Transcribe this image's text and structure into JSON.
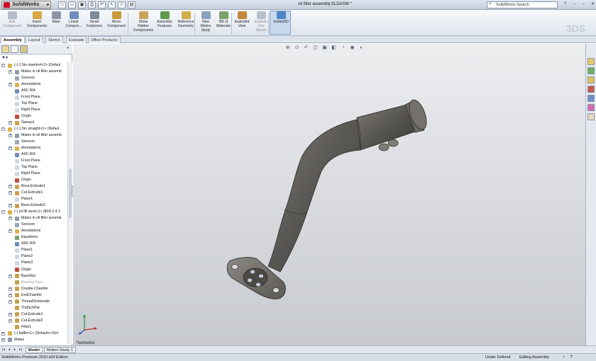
{
  "app": {
    "brand": "SolidWorks",
    "window_title": "oil filler assembly.SLDASM *"
  },
  "quick_access": [
    {
      "name": "new-icon",
      "glyph": "□"
    },
    {
      "name": "open-icon",
      "glyph": "▭"
    },
    {
      "name": "save-icon",
      "glyph": "▣"
    },
    {
      "name": "print-icon",
      "glyph": "⎙"
    },
    {
      "name": "undo-icon",
      "glyph": "↶"
    },
    {
      "name": "select-icon",
      "glyph": "↖"
    },
    {
      "name": "rebuild-icon",
      "glyph": "⚐"
    },
    {
      "name": "options-icon",
      "glyph": "▤"
    }
  ],
  "search": {
    "value": "SolidWorks Search"
  },
  "window_controls": [
    "?",
    "−",
    "▫",
    "✕"
  ],
  "commands": [
    {
      "name": "edit-component",
      "label": "Edit\nComponent",
      "disabled": true,
      "color": "#b4bcc8"
    },
    {
      "name": "insert-components",
      "label": "Insert\nComponents",
      "color": "#d7a640"
    },
    {
      "name": "mate",
      "label": "Mate",
      "color": "#8a96a8"
    },
    {
      "name": "linear-component-pattern",
      "label": "Linear\nCompon...",
      "color": "#6f8fc2"
    },
    {
      "name": "smart-fasteners",
      "label": "Smart\nFasteners",
      "color": "#7e8a99"
    },
    {
      "name": "move-component",
      "label": "Move\nComponent",
      "color": "#c99a3a"
    },
    {
      "name": "show-hidden-components",
      "label": "Show\nHidden\nComponents",
      "color": "#c9a45a"
    },
    {
      "name": "assembly-features",
      "label": "Assembly\nFeatures",
      "color": "#5f9a4f"
    },
    {
      "name": "reference-geometry",
      "label": "Reference\nGeometry",
      "color": "#d2b04c"
    },
    {
      "name": "new-motion-study",
      "label": "New\nMotion\nStudy",
      "color": "#8ca0bb"
    },
    {
      "name": "bill-of-materials",
      "label": "Bill of\nMaterials",
      "color": "#7ca06a"
    },
    {
      "name": "exploded-view",
      "label": "Exploded\nView",
      "color": "#c0893a"
    },
    {
      "name": "explode-line-sketch",
      "label": "Explode\nLine\nSketch",
      "disabled": true,
      "color": "#b7bfcb"
    },
    {
      "name": "instant3d",
      "label": "Instant3D",
      "color": "#4f86c6"
    }
  ],
  "tabs": [
    "Assembly",
    "Layout",
    "Sketch",
    "Evaluate",
    "Office Products"
  ],
  "active_tab": "Assembly",
  "tree": [
    {
      "depth": 0,
      "exp": "−",
      "icon": "part",
      "text": "(-) 1.5in mandrel<2> (Defaul"
    },
    {
      "depth": 1,
      "exp": "+",
      "icon": "mates",
      "text": "Mates in oil filler assemb"
    },
    {
      "depth": 1,
      "exp": "",
      "icon": "sensor",
      "text": "Sensors"
    },
    {
      "depth": 1,
      "exp": "+",
      "icon": "annot",
      "text": "Annotations"
    },
    {
      "depth": 1,
      "exp": "",
      "icon": "material",
      "text": "AISI 304"
    },
    {
      "depth": 1,
      "exp": "",
      "icon": "plane",
      "text": "Front Plane"
    },
    {
      "depth": 1,
      "exp": "",
      "icon": "plane",
      "text": "Top Plane"
    },
    {
      "depth": 1,
      "exp": "",
      "icon": "plane",
      "text": "Right Plane"
    },
    {
      "depth": 1,
      "exp": "",
      "icon": "origin",
      "text": "Origin"
    },
    {
      "depth": 1,
      "exp": "+",
      "icon": "feature",
      "text": "Sweep1"
    },
    {
      "depth": 0,
      "exp": "−",
      "icon": "part",
      "text": "(-) 1.5in straight<1> (Defaul"
    },
    {
      "depth": 1,
      "exp": "+",
      "icon": "mates",
      "text": "Mates in oil filler assemb"
    },
    {
      "depth": 1,
      "exp": "",
      "icon": "sensor",
      "text": "Sensors"
    },
    {
      "depth": 1,
      "exp": "+",
      "icon": "annot",
      "text": "Annotations"
    },
    {
      "depth": 1,
      "exp": "",
      "icon": "material",
      "text": "AISI 304"
    },
    {
      "depth": 1,
      "exp": "",
      "icon": "plane",
      "text": "Front Plane"
    },
    {
      "depth": 1,
      "exp": "",
      "icon": "plane",
      "text": "Top Plane"
    },
    {
      "depth": 1,
      "exp": "",
      "icon": "plane",
      "text": "Right Plane"
    },
    {
      "depth": 1,
      "exp": "",
      "icon": "origin",
      "text": "Origin"
    },
    {
      "depth": 1,
      "exp": "+",
      "icon": "feature",
      "text": "Boss-Extrude1"
    },
    {
      "depth": 1,
      "exp": "+",
      "icon": "feature",
      "text": "Cut-Extrude1"
    },
    {
      "depth": 1,
      "exp": "",
      "icon": "plane",
      "text": "Plane1"
    },
    {
      "depth": 1,
      "exp": "+",
      "icon": "feature",
      "text": "Boss-Extrude2"
    },
    {
      "depth": 0,
      "exp": "−",
      "icon": "part",
      "text": "(-) oil fill neck<1> (B18.2.4.1"
    },
    {
      "depth": 1,
      "exp": "+",
      "icon": "mates",
      "text": "Mates in oil filler assemb"
    },
    {
      "depth": 1,
      "exp": "",
      "icon": "sensor",
      "text": "Sensors"
    },
    {
      "depth": 1,
      "exp": "+",
      "icon": "annot",
      "text": "Annotations"
    },
    {
      "depth": 1,
      "exp": "",
      "icon": "equation",
      "text": "Equations"
    },
    {
      "depth": 1,
      "exp": "",
      "icon": "material",
      "text": "AISI 304"
    },
    {
      "depth": 1,
      "exp": "",
      "icon": "plane",
      "text": "Plane1"
    },
    {
      "depth": 1,
      "exp": "",
      "icon": "plane",
      "text": "Plane2"
    },
    {
      "depth": 1,
      "exp": "",
      "icon": "plane",
      "text": "Plane3"
    },
    {
      "depth": 1,
      "exp": "",
      "icon": "origin",
      "text": "Origin"
    },
    {
      "depth": 1,
      "exp": "+",
      "icon": "feature",
      "text": "BaseNut"
    },
    {
      "depth": 1,
      "exp": "",
      "icon": "feature",
      "text": "Bearing-Face",
      "dim": true
    },
    {
      "depth": 1,
      "exp": "+",
      "icon": "feature",
      "text": "Double-Chamfer"
    },
    {
      "depth": 1,
      "exp": "+",
      "icon": "feature",
      "text": "EndChamfer"
    },
    {
      "depth": 1,
      "exp": "+",
      "icon": "feature",
      "text": "ThreadSchematic"
    },
    {
      "depth": 1,
      "exp": "",
      "icon": "feature",
      "text": "ThdSchPat"
    },
    {
      "depth": 1,
      "exp": "+",
      "icon": "feature",
      "text": "Cut-Extrude1"
    },
    {
      "depth": 1,
      "exp": "+",
      "icon": "feature",
      "text": "Cut-Extrude2"
    },
    {
      "depth": 1,
      "exp": "",
      "icon": "feature",
      "text": "Fillet1"
    },
    {
      "depth": 0,
      "exp": "+",
      "icon": "part",
      "text": "(-) baffle<1> (Default<<Def"
    },
    {
      "depth": 0,
      "exp": "+",
      "icon": "mates",
      "text": "Mates"
    }
  ],
  "viewport": {
    "view_label": "*Isometric"
  },
  "model_tabs": [
    "Model",
    "Motion Study 1"
  ],
  "active_model_tab": "Model",
  "status": {
    "edition": "SolidWorks Premium 2010 x64 Edition",
    "defined": "Under Defined",
    "editing": "Editing Assembly"
  }
}
